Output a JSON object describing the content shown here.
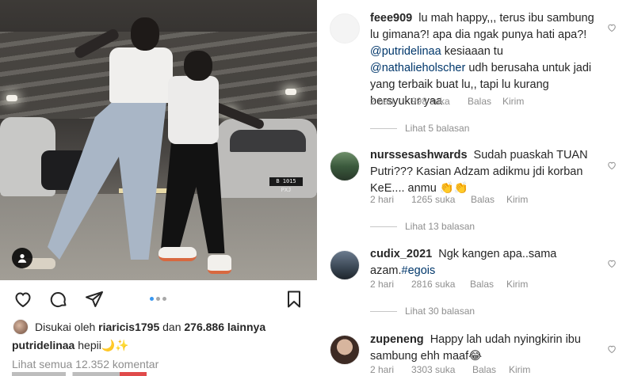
{
  "post": {
    "carousel": {
      "total": 3,
      "active": 0
    },
    "liked_by_prefix": "Disukai oleh",
    "liked_by_user": "riaricis1795",
    "liked_by_and": "dan",
    "liked_by_others": "276.886 lainnya",
    "caption_user": "putridelinaa",
    "caption_text": "hepii🌙✨",
    "view_all_comments": "Lihat semua 12.352 komentar",
    "car_plate": "B 1015 PXJ"
  },
  "icons": {
    "tag": "person-tag-icon",
    "like": "heart-icon",
    "comment": "comment-bubble-icon",
    "share": "paper-plane-icon",
    "save": "bookmark-icon"
  },
  "colors": {
    "text": "#262626",
    "muted": "#8e8e8e",
    "mention": "#00376b",
    "carousel_active": "#3897f0"
  },
  "comments": [
    {
      "user": "feee909",
      "text_1": "lu mah happy,,, terus ibu sambung lu gimana?! apa dia ngak punya hati apa?!",
      "mention_1": "@putridelinaa",
      "text_2": "kesiaaan tu",
      "mention_2": "@nathalieholscher",
      "text_3": "udh berusaha untuk jadi yang terbaik buat lu,, tapi lu kurang bersyukur yaa",
      "time": "2 hari",
      "likes": "998 suka",
      "reply": "Balas",
      "send": "Kirim",
      "view_replies": "Lihat 5 balasan"
    },
    {
      "user": "nurssesashwards",
      "text": "Sudah puaskah TUAN Putri??? Kasian Adzam adikmu jdi korban KeE.... anmu 👏👏",
      "time": "2 hari",
      "likes": "1265 suka",
      "reply": "Balas",
      "send": "Kirim",
      "view_replies": "Lihat 13 balasan"
    },
    {
      "user": "cudix_2021",
      "text": "Ngk kangen apa..sama azam.",
      "hashtag": "#egois",
      "time": "2 hari",
      "likes": "2816 suka",
      "reply": "Balas",
      "send": "Kirim",
      "view_replies": "Lihat 30 balasan"
    },
    {
      "user": "zupeneng",
      "text": "Happy lah udah nyingkirin ibu sambung ehh maaf😂",
      "time": "2 hari",
      "likes": "3303 suka",
      "reply": "Balas",
      "send": "Kirim"
    }
  ]
}
